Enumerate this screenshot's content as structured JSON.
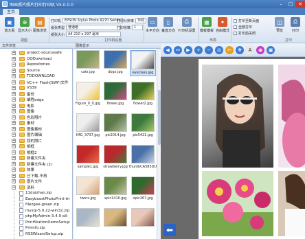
{
  "window": {
    "title": "图画照片照片打印打印机 V5.0.0.0"
  },
  "tabs": [
    "主页"
  ],
  "ribbon": {
    "buttons": [
      {
        "label": "放大看",
        "icon": "photo-icon",
        "color": "#3b7ac9"
      },
      {
        "label": "显示大小",
        "icon": "zoom-icon",
        "color": "#4aa04a"
      },
      {
        "label": "图像浏览",
        "icon": "browse-icon",
        "color": "#e08a2c"
      }
    ],
    "group1_label": "视图",
    "printer_label": "打印机",
    "printer_value": "EPSON Stylus Photo R270 Series",
    "paper_type_label": "纸张类型",
    "paper_type_value": "普通纸",
    "paper_size_label": "纸张大小",
    "paper_size_value": "A4 210 x 297 毫米",
    "group2_label": "打印机设置",
    "dpi_label": "打印分辨率",
    "dpi_value": "300",
    "copies_label": "打印份数",
    "copies_value": "1",
    "print_buttons": [
      {
        "label": "水平方向",
        "color": "#6c8fbf"
      },
      {
        "label": "垂直方向",
        "color": "#6c8fbf"
      },
      {
        "label": "打印机设置",
        "color": "#6c8fbf"
      },
      {
        "label": "模板模板",
        "color": "#4aa04a"
      },
      {
        "label": "自由模式",
        "color": "#d65a2a"
      }
    ],
    "group3_label": "布局",
    "checks": [
      "打印至新页面",
      "全部打印",
      "打印后关闭"
    ],
    "right_buttons": [
      {
        "label": "预览",
        "color": "#7c9bc4"
      },
      {
        "label": "打印",
        "color": "#5a7db0"
      }
    ],
    "group4_label": "打印"
  },
  "panels": {
    "tree_title": "文件浏览",
    "thumbs_title": "图像显示"
  },
  "tree": [
    {
      "label": "project-sourcesafe",
      "type": "folder"
    },
    {
      "label": "QQDownload",
      "type": "folder"
    },
    {
      "label": "Repositories",
      "type": "folder"
    },
    {
      "label": "Source",
      "type": "folder"
    },
    {
      "label": "TDDOWNLOAD",
      "type": "folder"
    },
    {
      "label": "VC++ Flash(SWF)文件",
      "type": "folder"
    },
    {
      "label": "VS39",
      "type": "folder"
    },
    {
      "label": "备份",
      "type": "folder"
    },
    {
      "label": "编程edge",
      "type": "folder"
    },
    {
      "label": "电影",
      "type": "folder"
    },
    {
      "label": "图像",
      "type": "folder"
    },
    {
      "label": "色彩照片",
      "type": "folder"
    },
    {
      "label": "素材",
      "type": "folder"
    },
    {
      "label": "图像素材",
      "type": "folder"
    },
    {
      "label": "图片编辑",
      "type": "folder"
    },
    {
      "label": "我的照片",
      "type": "folder"
    },
    {
      "label": "相框",
      "type": "folder"
    },
    {
      "label": "相框2",
      "type": "folder"
    },
    {
      "label": "新建文件夹",
      "type": "folder"
    },
    {
      "label": "新建文件夹 (2)",
      "type": "folder"
    },
    {
      "label": "效果",
      "type": "folder"
    },
    {
      "label": "已下载-不再",
      "type": "folder"
    },
    {
      "label": "图片文件",
      "type": "folder"
    },
    {
      "label": "资料",
      "type": "folder"
    },
    {
      "label": "11duizhan.zip",
      "type": "file"
    },
    {
      "label": "EasyboostPhotoPrint-tri",
      "type": "file"
    },
    {
      "label": "filezgee-green.zip",
      "type": "file"
    },
    {
      "label": "mysql-5.0.22-win32.zip",
      "type": "file"
    },
    {
      "label": "phpMyAdmin-3.4.9-all-",
      "type": "file"
    },
    {
      "label": "PrintStationDemoSetup",
      "type": "file"
    },
    {
      "label": "PmInfo.zip",
      "type": "file"
    },
    {
      "label": "RSSWizardSetup.zip",
      "type": "file"
    }
  ],
  "thumbnails": [
    {
      "caption": "cats.jpg",
      "colors": [
        "#7a9a5c",
        "#c9b48a"
      ],
      "selected": false
    },
    {
      "caption": "dogs.jpg",
      "colors": [
        "#3b6fb0",
        "#e0a94a"
      ],
      "selected": false
    },
    {
      "caption": "eyeclass.jpg",
      "colors": [
        "#f3f3f3",
        "#4a4a4a"
      ],
      "selected": true
    },
    {
      "caption": "Figure_0_0.jpg",
      "colors": [
        "#f4f0e8",
        "#f0c23a"
      ],
      "selected": false
    },
    {
      "caption": "flower.jpg",
      "colors": [
        "#2e6b3a",
        "#d94b8a"
      ],
      "selected": false
    },
    {
      "caption": "flower2.jpg",
      "colors": [
        "#3d6e2a",
        "#e8d25a"
      ],
      "selected": false
    },
    {
      "caption": "IMG_3737.jpg",
      "colors": [
        "#eeeeee",
        "#9a9a9a"
      ],
      "selected": false
    },
    {
      "caption": "pic2014.jpg",
      "colors": [
        "#5f7a4a",
        "#b8c4a8"
      ],
      "selected": false
    },
    {
      "caption": "pic5421.jpg",
      "colors": [
        "#3e7a3e",
        "#a8c86a"
      ],
      "selected": false
    },
    {
      "caption": "sample1.jpg",
      "colors": [
        "#c22a2a",
        "#e86a4a"
      ],
      "selected": false
    },
    {
      "caption": "strawberry.jpg",
      "colors": [
        "#b8282e",
        "#4a7a3a"
      ],
      "selected": false
    },
    {
      "caption": "thumbCA585DU",
      "colors": [
        "#4a70a8",
        "#c8d4e0"
      ],
      "selected": false
    },
    {
      "caption": "twins.jpg",
      "colors": [
        "#f2e3d2",
        "#d8a078"
      ],
      "selected": false
    },
    {
      "caption": "xpic1410.jpg",
      "colors": [
        "#6a8a4a",
        "#c8c8a8"
      ],
      "selected": false
    },
    {
      "caption": "xpic267.jpg",
      "colors": [
        "#2e6a2e",
        "#d83a5a"
      ],
      "selected": false
    },
    {
      "caption": "",
      "colors": [
        "#a8b8c8",
        "#e8e0d0"
      ],
      "selected": false
    },
    {
      "caption": "",
      "colors": [
        "#d8b880",
        "#6a5030"
      ],
      "selected": false
    },
    {
      "caption": "",
      "colors": [
        "#e8c8b8",
        "#8a5a4a"
      ],
      "selected": false
    }
  ],
  "canvas_tools": [
    {
      "icon": "left-arrow-icon",
      "color": "#3a7bd5",
      "glyph": "◀"
    },
    {
      "icon": "both-arrow-icon",
      "color": "#3a7bd5",
      "glyph": "↔"
    },
    {
      "icon": "right-arrow-icon",
      "color": "#3a7bd5",
      "glyph": "▶"
    },
    {
      "icon": "zoom-in-icon",
      "color": "#3a7bd5",
      "glyph": "+"
    },
    {
      "icon": "zoom-out-icon",
      "color": "#3a7bd5",
      "glyph": "−"
    },
    {
      "icon": "fit-icon",
      "color": "#3a7bd5",
      "glyph": "◎"
    },
    {
      "icon": "crop-icon",
      "color": "#e6a020",
      "glyph": "✂"
    },
    {
      "icon": "move-icon",
      "color": "#3a7bd5",
      "glyph": "✥"
    },
    {
      "icon": "text-icon",
      "color": "#e8e8e8",
      "glyph": "A"
    },
    {
      "icon": "color-wheel-icon",
      "color": "#c83ac8",
      "glyph": "◉"
    },
    {
      "icon": "border-icon",
      "color": "#3a7bd5",
      "glyph": "▣"
    }
  ],
  "canvas": {
    "back_glyph": "⬅"
  }
}
